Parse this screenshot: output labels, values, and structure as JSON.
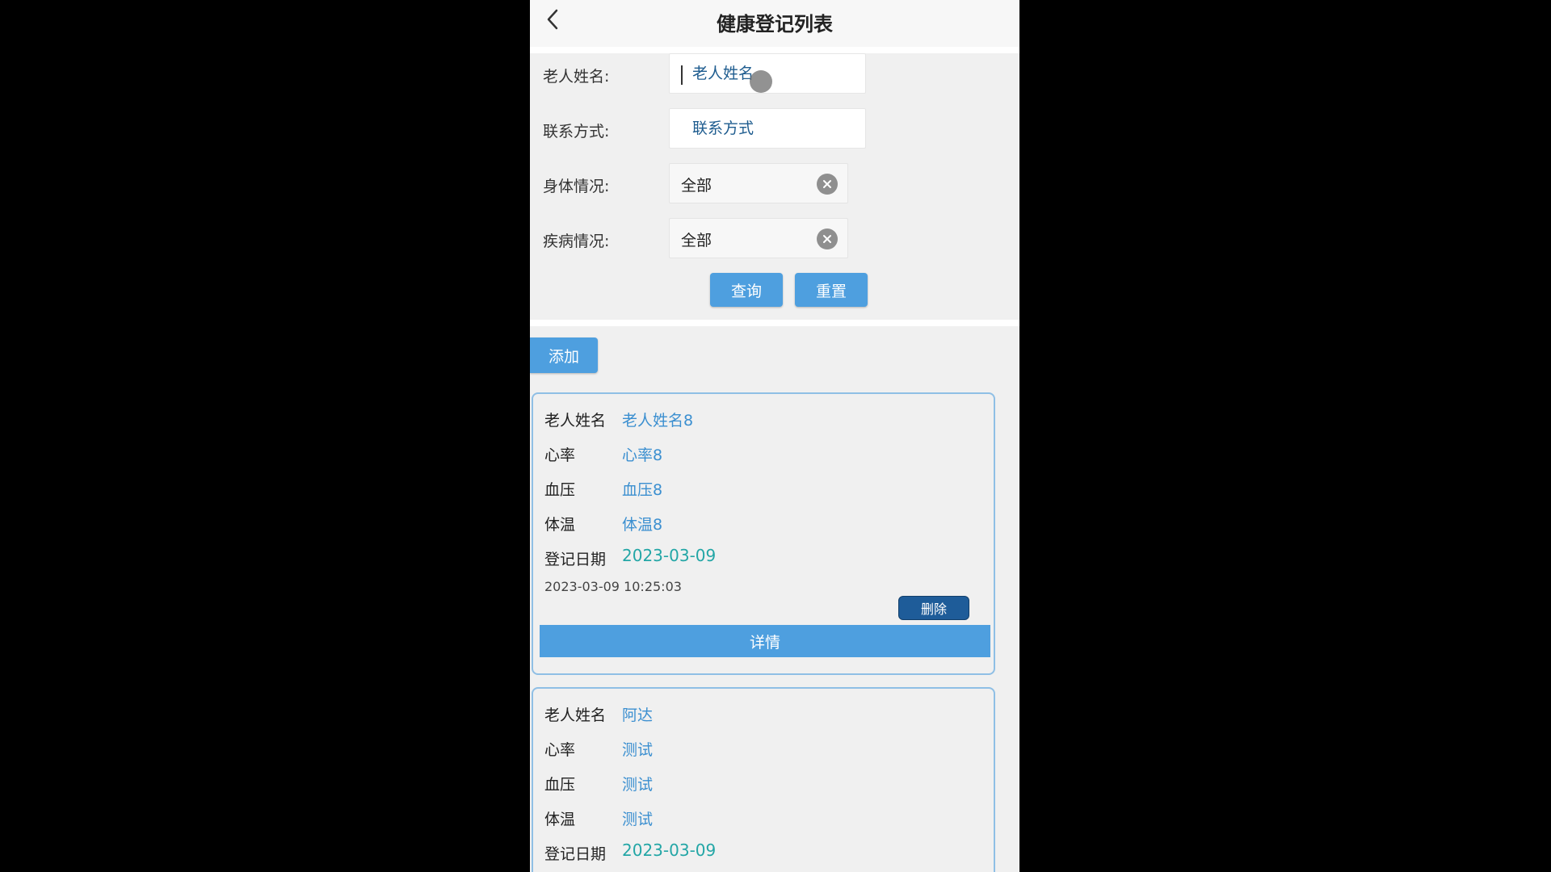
{
  "header": {
    "title": "健康登记列表",
    "back_icon": "chevron-left-icon"
  },
  "search": {
    "name_label": "老人姓名:",
    "name_placeholder": "老人姓名",
    "contact_label": "联系方式:",
    "contact_placeholder": "联系方式",
    "body_label": "身体情况:",
    "body_value": "全部",
    "disease_label": "疾病情况:",
    "disease_value": "全部",
    "query_label": "查询",
    "reset_label": "重置"
  },
  "toolbar": {
    "add_label": "添加"
  },
  "fields": {
    "name": "老人姓名",
    "heart_rate": "心率",
    "blood_pressure": "血压",
    "temperature": "体温",
    "reg_date": "登记日期"
  },
  "records": [
    {
      "name": "老人姓名8",
      "heart_rate": "心率8",
      "blood_pressure": "血压8",
      "temperature": "体温8",
      "reg_date": "2023-03-09",
      "created": "2023-03-09 10:25:03",
      "delete_label": "删除",
      "detail_label": "详情"
    },
    {
      "name": "阿达",
      "heart_rate": "测试",
      "blood_pressure": "测试",
      "temperature": "测试",
      "reg_date": "2023-03-09"
    }
  ],
  "colors": {
    "primary": "#4e9fdf",
    "danger_button": "#1e5c99",
    "value_text": "#3b8fd0",
    "date_text": "#23a6a6",
    "card_border": "#8fbfe5"
  }
}
